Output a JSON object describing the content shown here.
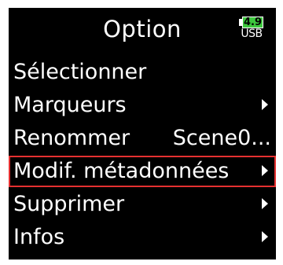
{
  "header": {
    "title": "Option",
    "battery": {
      "value": "4.9",
      "source": "USB",
      "color": "#3ec83e"
    }
  },
  "menu": {
    "selected_index": 3,
    "selected_border_color": "#e53030",
    "items": [
      {
        "label": "Sélectionner",
        "value": "",
        "has_submenu": false
      },
      {
        "label": "Marqueurs",
        "value": "",
        "has_submenu": true
      },
      {
        "label": "Renommer",
        "value": "Scene0...",
        "has_submenu": false
      },
      {
        "label": "Modif. métadonnées",
        "value": "",
        "has_submenu": true
      },
      {
        "label": "Supprimer",
        "value": "",
        "has_submenu": true
      },
      {
        "label": "Infos",
        "value": "",
        "has_submenu": true
      }
    ]
  }
}
